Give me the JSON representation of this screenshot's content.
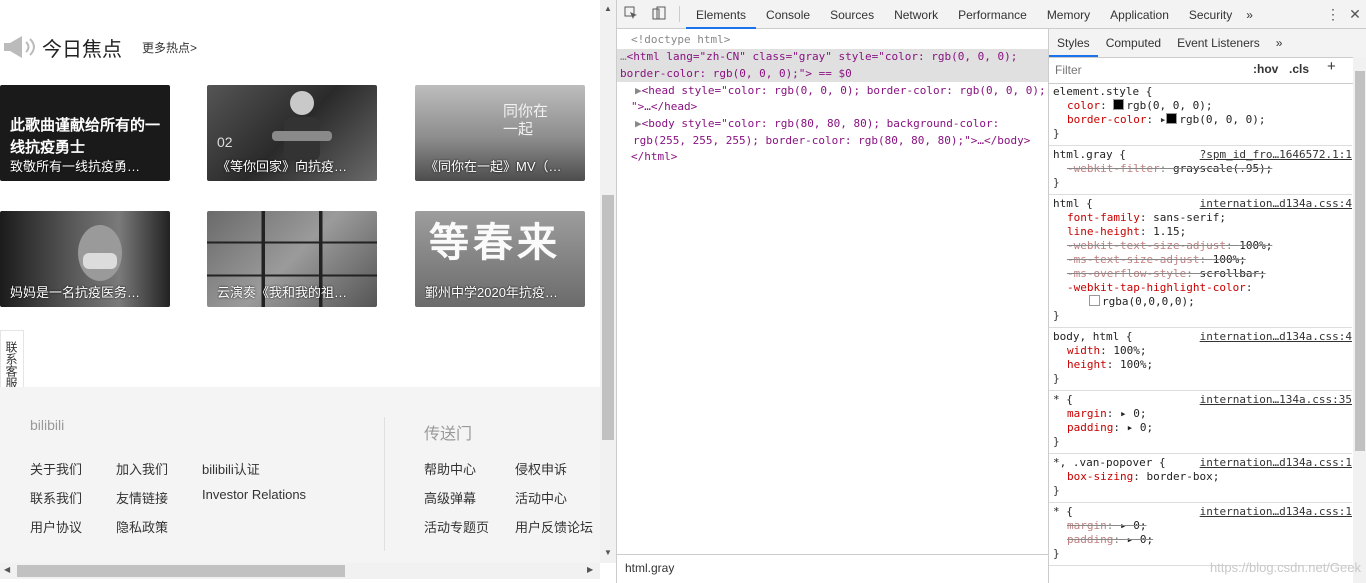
{
  "site": {
    "section_title": "今日焦点",
    "more_link": "更多热点>",
    "cards": [
      {
        "caption": "致敬所有一线抗疫勇…",
        "overlay": "此歌曲谨献给所有的一线抗疫勇士"
      },
      {
        "caption": "《等你回家》向抗疫…",
        "overlay": "02"
      },
      {
        "caption": "《同你在一起》MV（…",
        "overlay": "同你在一起"
      },
      {
        "caption": "妈妈是一名抗疫医务…",
        "overlay": ""
      },
      {
        "caption": "云演奏《我和我的祖…",
        "overlay": ""
      },
      {
        "caption": "鄞州中学2020年抗疫…",
        "overlay": "等春来"
      }
    ],
    "side_tab": "联系客服",
    "footer": {
      "brand": "bilibili",
      "portal_title": "传送门",
      "links_left": [
        "关于我们",
        "加入我们",
        "bilibili认证",
        "联系我们",
        "友情链接",
        "Investor Relations",
        "用户协议",
        "隐私政策"
      ],
      "links_right": [
        "帮助中心",
        "侵权申诉",
        "高级弹幕",
        "活动中心",
        "活动专题页",
        "用户反馈论坛"
      ]
    }
  },
  "devtools": {
    "tabs": [
      "Elements",
      "Console",
      "Sources",
      "Network",
      "Performance",
      "Memory",
      "Application",
      "Security"
    ],
    "active_tab": "Elements",
    "more_tabs": "»",
    "dom": {
      "doctype": "<!doctype html>",
      "html_open": "<html lang=\"zh-CN\" class=\"gray\" style=\"color: rgb(0, 0, 0);",
      "html_cont": "border-color: rgb(0, 0, 0);\"> == $0",
      "head": "<head style=\"color: rgb(0, 0, 0); border-color: rgb(0, 0, 0);",
      "head_cont": "\">…</head>",
      "body": "<body style=\"color: rgb(80, 80, 80); background-color:",
      "body_cont": "rgb(255, 255, 255); border-color: rgb(80, 80, 80);\">…</body>",
      "html_close": "</html>"
    },
    "breadcrumb": "html.gray",
    "styles_tabs": [
      "Styles",
      "Computed",
      "Event Listeners",
      "»"
    ],
    "filter_placeholder": "Filter",
    "hov": ":hov",
    "cls": ".cls",
    "plus": "+",
    "rules": [
      {
        "selector": "element.style {",
        "source": "",
        "props": [
          {
            "name": "color",
            "value": "rgb(0, 0, 0);",
            "swatch": "#000000",
            "struck": false
          },
          {
            "name": "border-color",
            "value": "rgb(0, 0, 0);",
            "swatch": "#000000",
            "struck": false,
            "arrow": true
          }
        ]
      },
      {
        "selector": "html.gray {",
        "source": "?spm_id_fro…1646572.1:1",
        "props": [
          {
            "name": "-webkit-filter",
            "value": "grayscale(.95);",
            "struck": true
          }
        ]
      },
      {
        "selector": "html {",
        "source": "internation…d134a.css:4",
        "props": [
          {
            "name": "font-family",
            "value": "sans-serif;",
            "struck": false
          },
          {
            "name": "line-height",
            "value": "1.15;",
            "struck": false
          },
          {
            "name": "-webkit-text-size-adjust",
            "value": "100%;",
            "struck": true
          },
          {
            "name": "-ms-text-size-adjust",
            "value": "100%;",
            "struck": true
          },
          {
            "name": "-ms-overflow-style",
            "value": "scrollbar;",
            "struck": true
          },
          {
            "name": "-webkit-tap-highlight-color",
            "value": "",
            "struck": false
          },
          {
            "name": "",
            "value": "rgba(0,0,0,0);",
            "swatch": "#ffffff",
            "struck": false
          }
        ]
      },
      {
        "selector": "body, html {",
        "source": "internation…d134a.css:4",
        "props": [
          {
            "name": "width",
            "value": "100%;",
            "struck": false
          },
          {
            "name": "height",
            "value": "100%;",
            "struck": false
          }
        ]
      },
      {
        "selector": "* {",
        "source": "internation…134a.css:35",
        "props": [
          {
            "name": "margin",
            "value": "▸ 0;",
            "struck": false
          },
          {
            "name": "padding",
            "value": "▸ 0;",
            "struck": false
          }
        ]
      },
      {
        "selector": "*, .van-popover {",
        "source": "internation…d134a.css:1",
        "props": [
          {
            "name": "box-sizing",
            "value": "border-box;",
            "struck": false
          }
        ]
      },
      {
        "selector": "* {",
        "source": "internation…d134a.css:1",
        "props": [
          {
            "name": "margin",
            "value": "▸ 0;",
            "struck": true
          },
          {
            "name": "padding",
            "value": "▸ 0;",
            "struck": true
          }
        ]
      }
    ],
    "watermark": "https://blog.csdn.net/Geek"
  }
}
